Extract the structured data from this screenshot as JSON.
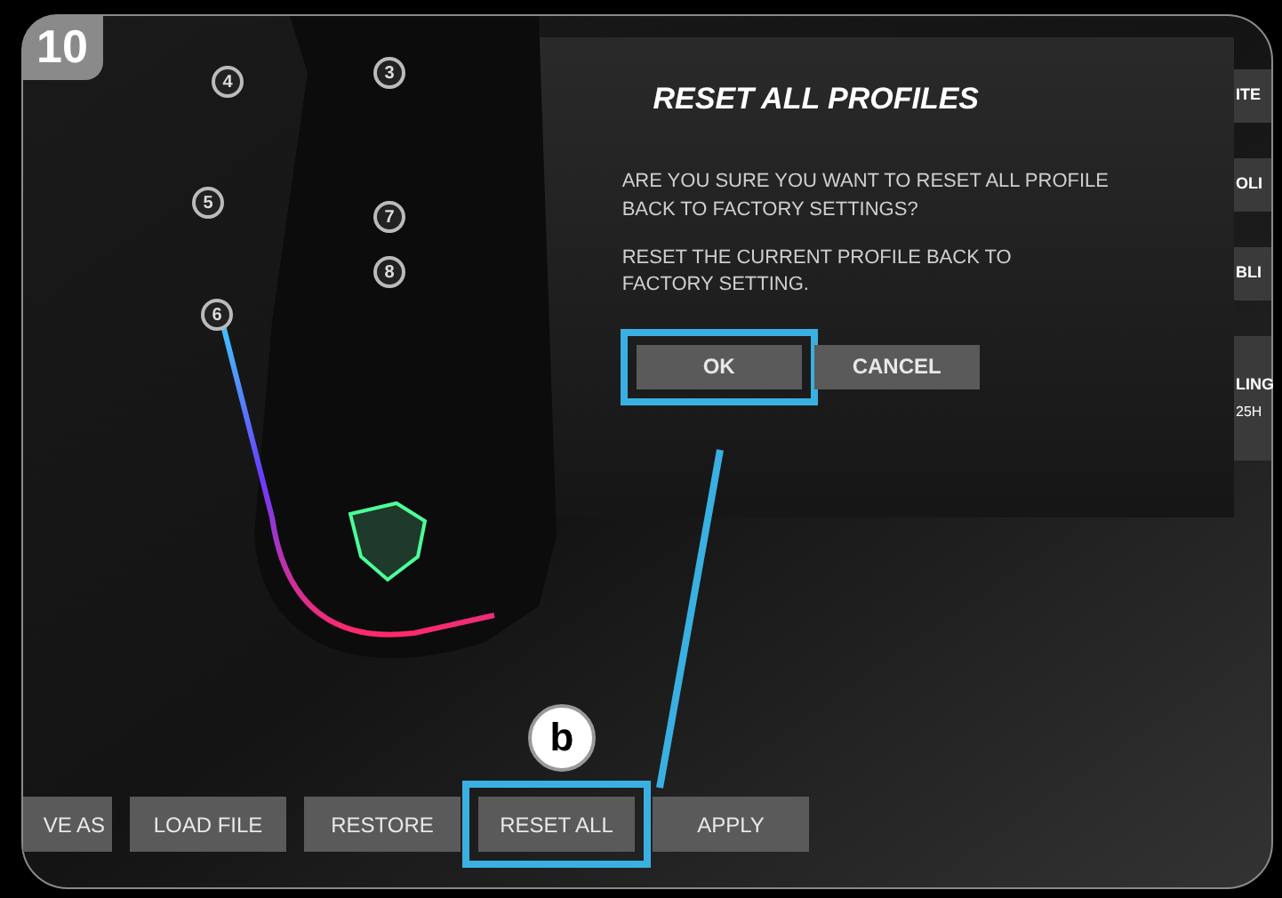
{
  "step_badge": "10",
  "mouse_button_labels": [
    "4",
    "3",
    "5",
    "7",
    "8",
    "6"
  ],
  "dialog": {
    "title": "RESET ALL PROFILES",
    "message": "ARE YOU SURE YOU WANT TO RESET ALL PROFILE BACK TO FACTORY SETTINGS?",
    "note": "RESET THE CURRENT PROFILE BACK TO FACTORY SETTING.",
    "buttons": [
      {
        "label": "OK",
        "highlighted": true
      },
      {
        "label": "CANCEL",
        "highlighted": false
      }
    ]
  },
  "side_tabs": [
    {
      "label": "ITE"
    },
    {
      "label": "OLI"
    },
    {
      "label": "BLI"
    },
    {
      "label": "LING",
      "sub": "25H"
    }
  ],
  "toolbar": {
    "buttons": [
      {
        "label": "VE AS",
        "highlighted": false
      },
      {
        "label": "LOAD FILE",
        "highlighted": false
      },
      {
        "label": "RESTORE",
        "highlighted": false
      },
      {
        "label": "RESET ALL",
        "highlighted": true
      },
      {
        "label": "APPLY",
        "highlighted": false
      }
    ]
  },
  "callout": {
    "label": "b"
  }
}
